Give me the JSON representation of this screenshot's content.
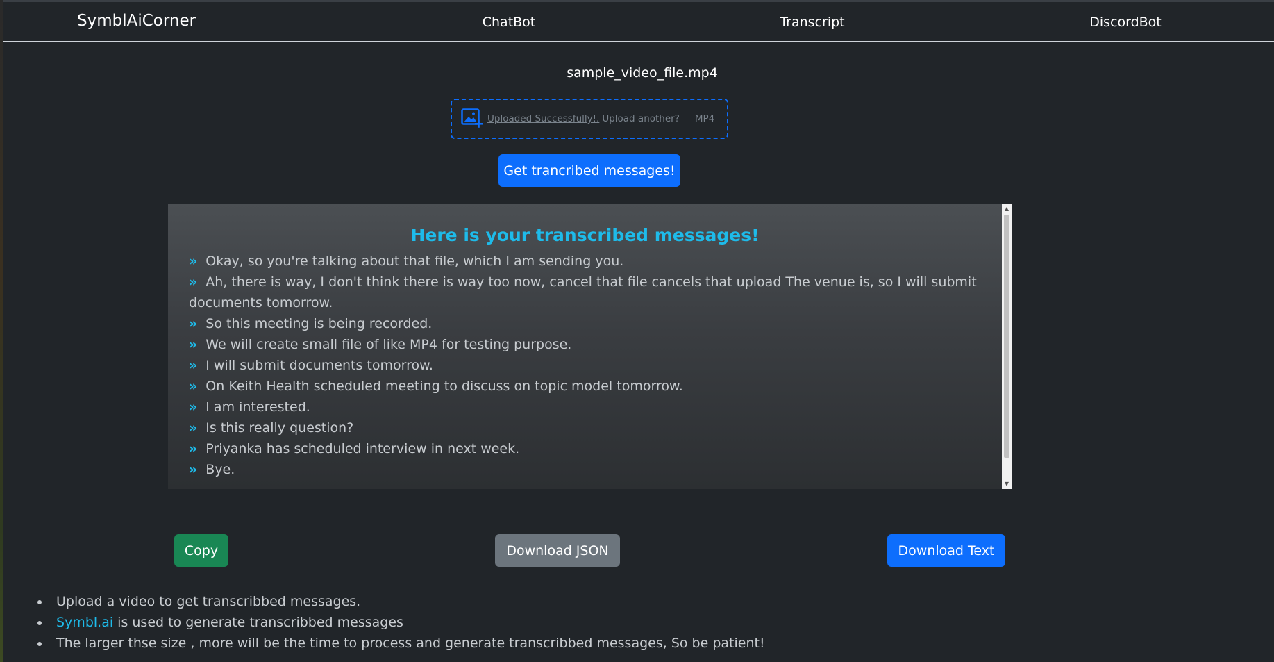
{
  "navbar": {
    "brand": "SymblAiCorner",
    "links": [
      "ChatBot",
      "Transcript",
      "DiscordBot"
    ]
  },
  "upload": {
    "file_name": "sample_video_file.mp4",
    "success_text": "Uploaded Successfully!.",
    "another_text": "Upload another?",
    "file_type": "MP4",
    "icon": "image-add-icon"
  },
  "get_button": "Get trancribed messages!",
  "transcript": {
    "title": "Here is your transcribed messages!",
    "marker": "»",
    "messages": [
      "Okay, so you're talking about that file, which I am sending you.",
      "Ah, there is way, I don't think there is way too now, cancel that file cancels that upload The venue is, so I will submit documents tomorrow.",
      "So this meeting is being recorded.",
      "We will create small file of like MP4 for testing purpose.",
      "I will submit documents tomorrow.",
      "On Keith Health scheduled meeting to discuss on topic model tomorrow.",
      "I am interested.",
      "Is this really question?",
      "Priyanka has scheduled interview in next week.",
      "Bye."
    ]
  },
  "actions": {
    "copy": "Copy",
    "download_json": "Download JSON",
    "download_text": "Download Text"
  },
  "notes": {
    "item1": "Upload a video to get transcribbed messages.",
    "item2_link": "Symbl.ai",
    "item2_rest": " is used to generate transcribbed messages",
    "item3": "The larger thse size , more will be the time to process and generate transcribbed messages, So be patient!"
  },
  "colors": {
    "background": "#212529",
    "primary": "#0d6efd",
    "success": "#198754",
    "secondary": "#6c757d",
    "accent": "#1ebbea"
  }
}
